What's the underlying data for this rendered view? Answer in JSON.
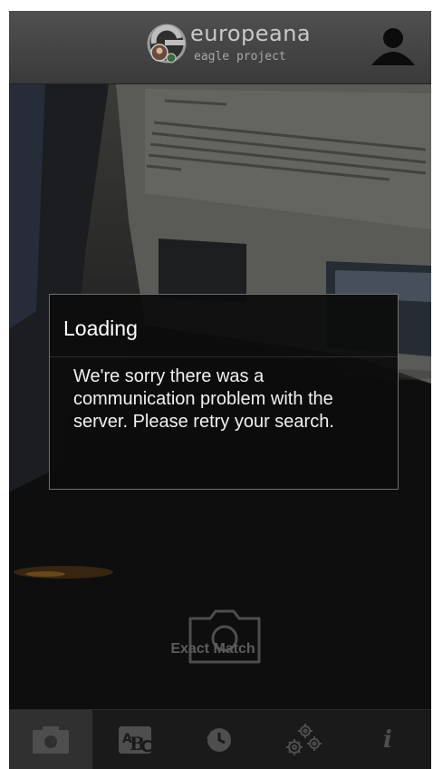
{
  "header": {
    "logo_title": "europeana",
    "logo_subtitle": "eagle project",
    "profile_icon": "user-silhouette-icon"
  },
  "dialog": {
    "title": "Loading",
    "message": "We're sorry there was a communication problem with the server. Please retry your search."
  },
  "capture": {
    "camera_icon": "camera-outline-icon",
    "label": "Exact Match"
  },
  "tabs": [
    {
      "id": "camera",
      "icon": "camera-icon",
      "active": true
    },
    {
      "id": "text",
      "icon": "abc-text-icon",
      "active": false
    },
    {
      "id": "history",
      "icon": "history-clock-icon",
      "active": false
    },
    {
      "id": "settings",
      "icon": "gears-icon",
      "active": false
    },
    {
      "id": "info",
      "icon": "info-icon",
      "glyph": "i",
      "active": false
    }
  ],
  "colors": {
    "header": "#474747",
    "tabbar": "#1a1a1a",
    "active_tab": "#303030",
    "dialog_border": "#6f6f6f"
  }
}
